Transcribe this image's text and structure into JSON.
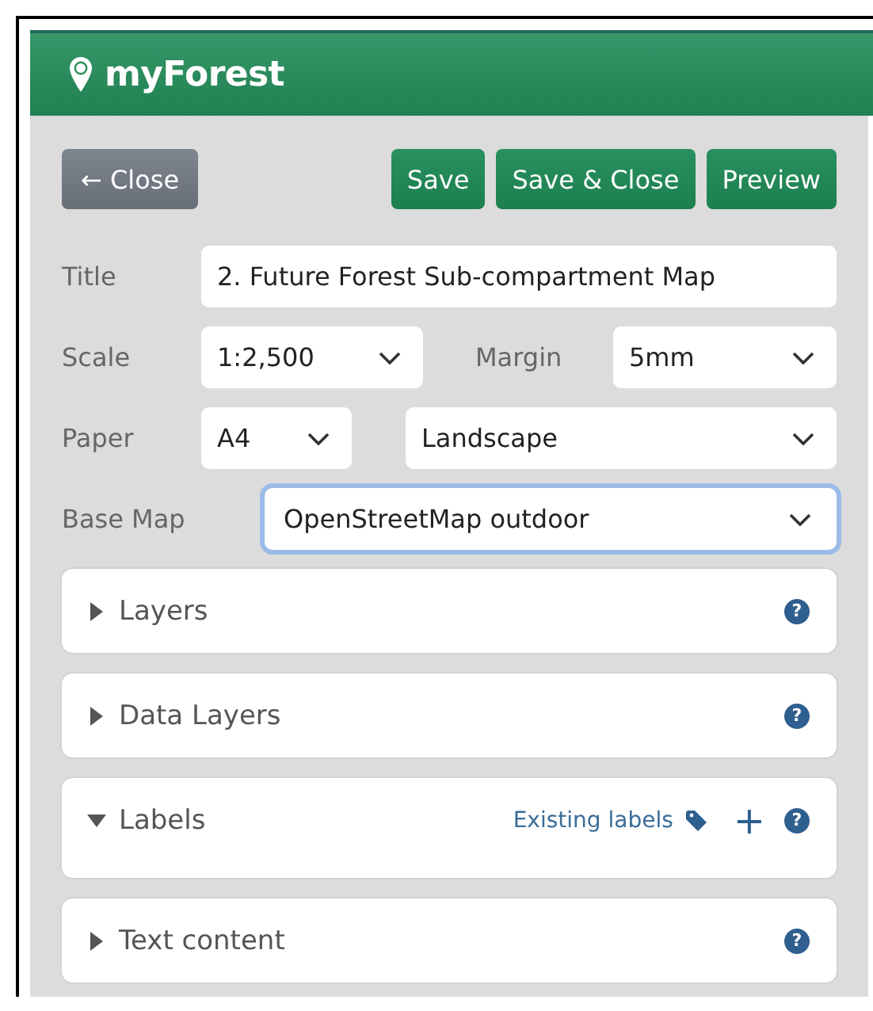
{
  "app": {
    "name": "myForest"
  },
  "toolbar": {
    "buttons": [
      {
        "label": "← Close",
        "kind": "secondary"
      },
      {
        "label": "Save",
        "kind": "primary"
      },
      {
        "label": "Save & Close",
        "kind": "primary"
      },
      {
        "label": "Preview",
        "kind": "primary"
      }
    ]
  },
  "form": {
    "title": {
      "label": "Title",
      "value": "2. Future Forest Sub-compartment Map"
    },
    "scale": {
      "label": "Scale",
      "value": "1:2,500"
    },
    "margin": {
      "label": "Margin",
      "value": "5mm"
    },
    "paper": {
      "label": "Paper",
      "size": "A4",
      "orientation": "Landscape"
    },
    "base_map": {
      "label": "Base Map",
      "value": "OpenStreetMap outdoor",
      "focused": true
    }
  },
  "sections": [
    {
      "title": "Layers",
      "expanded": false,
      "help": "?"
    },
    {
      "title": "Data Layers",
      "expanded": false,
      "help": "?"
    },
    {
      "title": "Labels",
      "expanded": true,
      "help": "?",
      "link": "Existing labels",
      "add": "+"
    },
    {
      "title": "Text content",
      "expanded": false,
      "help": "?"
    }
  ]
}
